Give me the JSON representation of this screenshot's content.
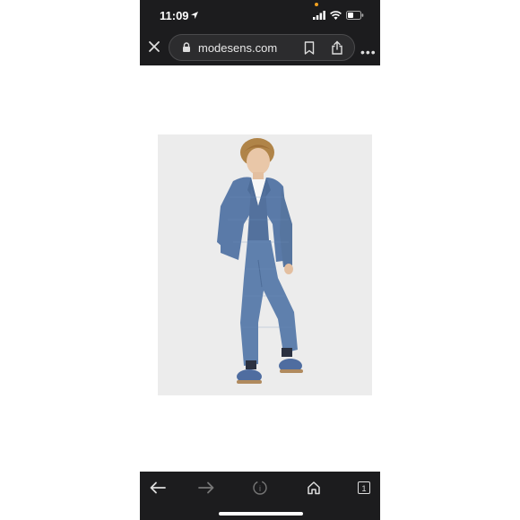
{
  "status_bar": {
    "time": "11:09"
  },
  "browser": {
    "url": "modesens.com",
    "tab_count": "1"
  },
  "content": {
    "image_description_icon": "product-photo",
    "colors": {
      "suit": "#5a7aa8",
      "background": "#ececec"
    }
  },
  "colors": {
    "chrome": "#1c1c1e",
    "accent_dot": "#f0a020"
  }
}
